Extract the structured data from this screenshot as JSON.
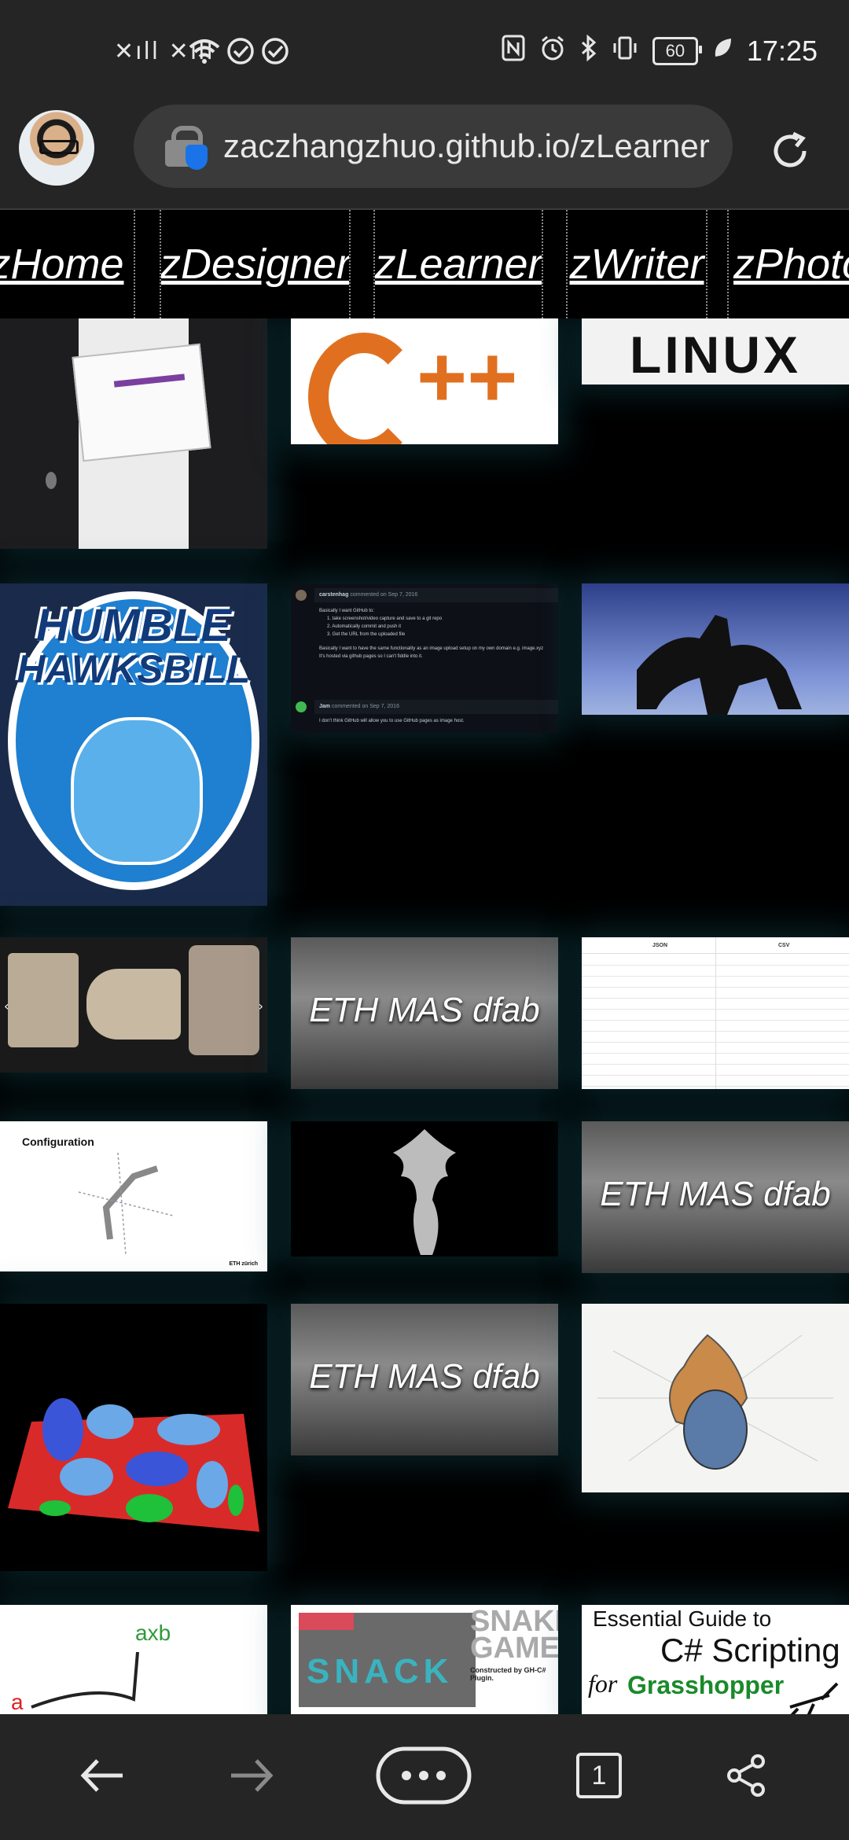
{
  "status_bar": {
    "time": "17:25",
    "battery": "60",
    "signal": "✕ıll ✕ıll",
    "icons": [
      "nfc-icon",
      "alarm-icon",
      "bluetooth-icon",
      "vibrate-icon",
      "battery-icon",
      "leaf-icon"
    ]
  },
  "browser": {
    "url": "zaczhangzhuo.github.io/zLearner",
    "reload_icon": "reload-icon",
    "lock_icon": "lock-shield-icon"
  },
  "nav": {
    "tabs": [
      {
        "label": "zHome"
      },
      {
        "label": "zDesigner"
      },
      {
        "label": "zLearner"
      },
      {
        "label": "zWriter"
      },
      {
        "label": "zPhoto"
      }
    ]
  },
  "tiles": {
    "cpp_text": "C++",
    "linux_text": "LINUX",
    "humble_line1": "HUMBLE",
    "humble_line2": "HAWKSBILL",
    "eth_label": "ETH MAS dfab",
    "config_title": "Configuration",
    "config_brand": "ETH zürich",
    "gh_user1": "carstenhag",
    "gh_meta1": "commented on Sep 7, 2016",
    "gh_line0": "Basically I want GitHub to:",
    "gh_line1": "1. take screenshot/video capture and save to a git repo",
    "gh_line2": "2. Automatically commit and push it",
    "gh_line3": "3. Get the URL from the uploaded file",
    "gh_line4": "Basically I want to have the same functionality as an image upload setup on my own domain e.g. image.xyz",
    "gh_line5": "It's hosted via github pages so I can't fiddle into it.",
    "gh_user2": "Jam",
    "gh_meta2": "commented on Sep 7, 2016",
    "gh_line6": "I don't think GitHub will allow you to use GitHub pages as image host.",
    "json_h1": "JSON",
    "json_h2": "CSV",
    "axb_text": "axb",
    "a_text": "a",
    "snake_title1": "SNAKE",
    "snake_title2": "GAME",
    "snake_sub": "Constructed by GH-C# Plugin.",
    "snake_word": "SNACK",
    "csharp_line1": "Essential Guide to",
    "csharp_line2": "C# Scripting",
    "csharp_for": "for",
    "csharp_line3": "Grasshopper"
  },
  "bottom_bar": {
    "tab_count": "1",
    "icons": [
      "back-arrow-icon",
      "forward-arrow-icon",
      "more-icon",
      "tabs-icon",
      "share-icon"
    ]
  },
  "colors": {
    "chrome_bg": "#252525",
    "url_field_bg": "#3a3a3a",
    "page_bg": "#000000",
    "tile_glow": "#14505a",
    "accent_blue": "#1a73e8"
  }
}
